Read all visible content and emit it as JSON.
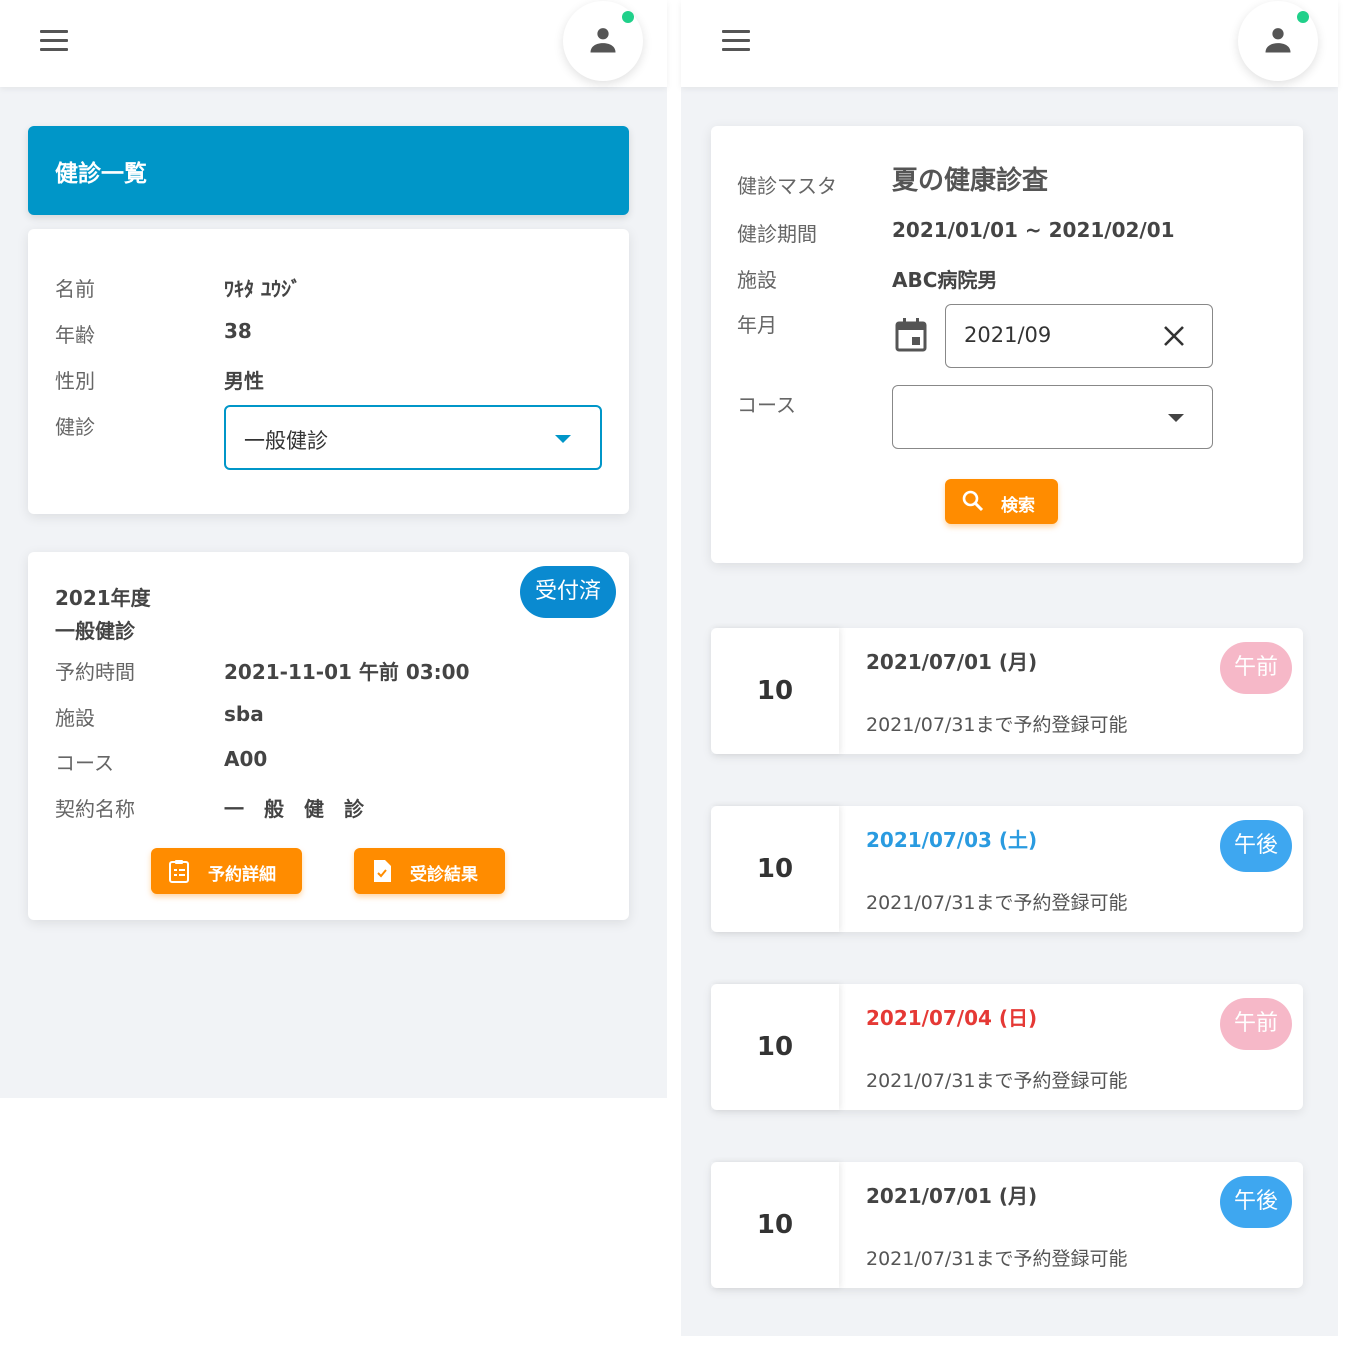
{
  "left": {
    "header_title": "健診一覧",
    "profile": {
      "name_label": "名前",
      "name_value": "ﾜｷﾀ ﾕｳｼﾞ",
      "age_label": "年齢",
      "age_value": "38",
      "sex_label": "性別",
      "sex_value": "男性",
      "kenshin_label": "健診",
      "kenshin_selected": "一般健診"
    },
    "booking": {
      "year": "2021年度",
      "type": "一般健診",
      "status": "受付済",
      "time_label": "予約時間",
      "time_value": "2021-11-01 午前 03:00",
      "facility_label": "施設",
      "facility_value": "sba",
      "course_label": "コース",
      "course_value": "A00",
      "contract_label": "契約名称",
      "contract_value": "一　般　健　診",
      "detail_button": "予約詳細",
      "result_button": "受診結果"
    }
  },
  "right": {
    "search": {
      "master_label": "健診マスタ",
      "master_value": "夏の健康診査",
      "period_label": "健診期間",
      "period_value": "2021/01/01 ~ 2021/02/01",
      "facility_label": "施設",
      "facility_value": "ABC病院男",
      "month_label": "年月",
      "month_value": "2021/09",
      "course_label": "コース",
      "course_value": "",
      "search_button": "検索"
    },
    "slots": [
      {
        "count": "10",
        "date": "2021/07/01 (月)",
        "note": "2021/07/31まで予約登録可能",
        "period": "午前",
        "date_color": "#444444",
        "badge_color": "#f6b8c8"
      },
      {
        "count": "10",
        "date": "2021/07/03 (土)",
        "note": "2021/07/31まで予約登録可能",
        "period": "午後",
        "date_color": "#2a9be0",
        "badge_color": "#3ea7f0"
      },
      {
        "count": "10",
        "date": "2021/07/04 (日)",
        "note": "2021/07/31まで予約登録可能",
        "period": "午前",
        "date_color": "#e53935",
        "badge_color": "#f6b8c8"
      },
      {
        "count": "10",
        "date": "2021/07/01 (月)",
        "note": "2021/07/31まで予約登録可能",
        "period": "午後",
        "date_color": "#444444",
        "badge_color": "#3ea7f0"
      }
    ]
  },
  "colors": {
    "primary": "#0096c8",
    "accent": "#ff8c00",
    "online_dot": "#20d08a",
    "status_badge": "#0a8ad0"
  }
}
